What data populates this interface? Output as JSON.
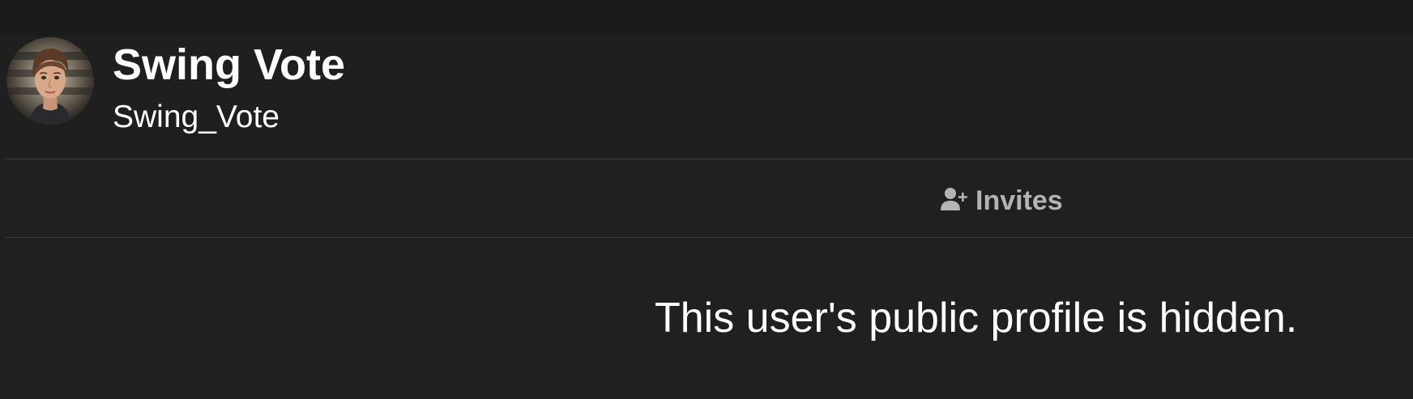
{
  "profile": {
    "display_name": "Swing Vote",
    "username": "Swing_Vote",
    "avatar": "user-avatar-portrait"
  },
  "tabs": [
    {
      "label": "Invites",
      "icon": "user-plus-icon"
    }
  ],
  "message": "This user's public profile is hidden.",
  "colors": {
    "background": "#202020",
    "header_background": "#1f1f1f",
    "tab_text": "#b4b4b4",
    "text": "#ffffff"
  }
}
